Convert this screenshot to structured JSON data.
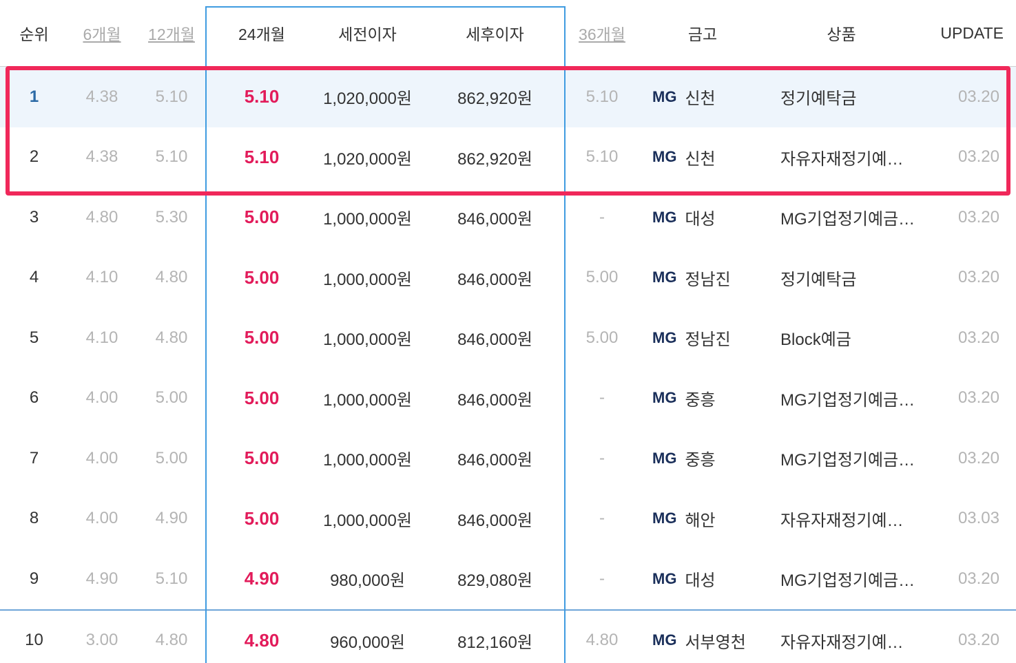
{
  "header": {
    "rank": "순위",
    "m6": "6개월",
    "m12": "12개월",
    "m24": "24개월",
    "pretax": "세전이자",
    "aftertax": "세후이자",
    "m36": "36개월",
    "bank": "금고",
    "product": "상품",
    "update": "UPDATE"
  },
  "colors": {
    "accent_rate": "#e21b5a",
    "highlight_border": "#f0285a",
    "column_box": "#3f9be0",
    "first_row_bg": "#eef5fc"
  },
  "rows": [
    {
      "rank": "1",
      "m6": "4.38",
      "m12": "5.10",
      "m24": "5.10",
      "pretax": "1,020,000원",
      "aftertax": "862,920원",
      "m36": "5.10",
      "bank_prefix": "MG",
      "bank": "신천",
      "product": "정기예탁금",
      "update": "03.20"
    },
    {
      "rank": "2",
      "m6": "4.38",
      "m12": "5.10",
      "m24": "5.10",
      "pretax": "1,020,000원",
      "aftertax": "862,920원",
      "m36": "5.10",
      "bank_prefix": "MG",
      "bank": "신천",
      "product": "자유자재정기예…",
      "update": "03.20"
    },
    {
      "rank": "3",
      "m6": "4.80",
      "m12": "5.30",
      "m24": "5.00",
      "pretax": "1,000,000원",
      "aftertax": "846,000원",
      "m36": "-",
      "bank_prefix": "MG",
      "bank": "대성",
      "product": "MG기업정기예금…",
      "update": "03.20"
    },
    {
      "rank": "4",
      "m6": "4.10",
      "m12": "4.80",
      "m24": "5.00",
      "pretax": "1,000,000원",
      "aftertax": "846,000원",
      "m36": "5.00",
      "bank_prefix": "MG",
      "bank": "정남진",
      "product": "정기예탁금",
      "update": "03.20"
    },
    {
      "rank": "5",
      "m6": "4.10",
      "m12": "4.80",
      "m24": "5.00",
      "pretax": "1,000,000원",
      "aftertax": "846,000원",
      "m36": "5.00",
      "bank_prefix": "MG",
      "bank": "정남진",
      "product": "Block예금",
      "update": "03.20"
    },
    {
      "rank": "6",
      "m6": "4.00",
      "m12": "5.00",
      "m24": "5.00",
      "pretax": "1,000,000원",
      "aftertax": "846,000원",
      "m36": "-",
      "bank_prefix": "MG",
      "bank": "중흥",
      "product": "MG기업정기예금…",
      "update": "03.20"
    },
    {
      "rank": "7",
      "m6": "4.00",
      "m12": "5.00",
      "m24": "5.00",
      "pretax": "1,000,000원",
      "aftertax": "846,000원",
      "m36": "-",
      "bank_prefix": "MG",
      "bank": "중흥",
      "product": "MG기업정기예금…",
      "update": "03.20"
    },
    {
      "rank": "8",
      "m6": "4.00",
      "m12": "4.90",
      "m24": "5.00",
      "pretax": "1,000,000원",
      "aftertax": "846,000원",
      "m36": "-",
      "bank_prefix": "MG",
      "bank": "해안",
      "product": "자유자재정기예…",
      "update": "03.03"
    },
    {
      "rank": "9",
      "m6": "4.90",
      "m12": "5.10",
      "m24": "4.90",
      "pretax": "980,000원",
      "aftertax": "829,080원",
      "m36": "-",
      "bank_prefix": "MG",
      "bank": "대성",
      "product": "MG기업정기예금…",
      "update": "03.20"
    },
    {
      "rank": "10",
      "m6": "3.00",
      "m12": "4.80",
      "m24": "4.80",
      "pretax": "960,000원",
      "aftertax": "812,160원",
      "m36": "4.80",
      "bank_prefix": "MG",
      "bank": "서부영천",
      "product": "자유자재정기예…",
      "update": "03.20"
    }
  ]
}
